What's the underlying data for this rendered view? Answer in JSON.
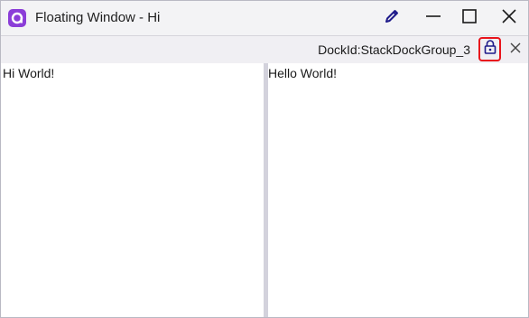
{
  "window": {
    "title": "Floating Window - Hi"
  },
  "dock": {
    "id_label": "DockId:StackDockGroup_3"
  },
  "panes": [
    {
      "text": "Hi World!"
    },
    {
      "text": "Hello World!"
    }
  ],
  "colors": {
    "accent": "#1e1a8a",
    "highlight_border": "#e8141c",
    "splitter": "#d3d2dc",
    "titlebar_bg": "#f3f3f5"
  },
  "icons": {
    "app": "app-logo-icon",
    "edit": "pencil-icon",
    "minimize": "minimize-icon",
    "maximize": "maximize-icon",
    "close": "close-icon",
    "lock": "lock-icon",
    "dock_close": "close-icon"
  }
}
